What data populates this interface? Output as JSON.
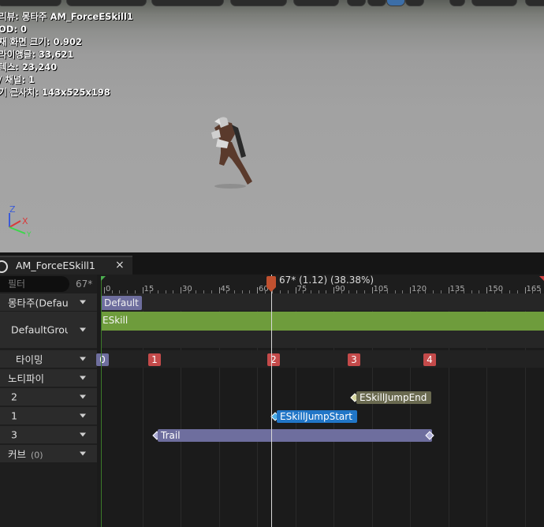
{
  "viewport": {
    "stats": [
      "리뷰: 몽타주 AM_ForceESkill1",
      "OD: 0",
      "재 화면 크기: 0.902",
      "라이앵글: 33,621",
      "텍스: 23,240",
      "/ 채널: 1",
      "기 근사치: 143x525x198"
    ],
    "axis": {
      "z": "Z",
      "x": "X",
      "y": "Y"
    }
  },
  "tab": {
    "title": "AM_ForceESkill1",
    "close": "×"
  },
  "left": {
    "filter_placeholder": "필터",
    "frame": "67*",
    "rows": {
      "montage": "몽타주(Defau",
      "group": "DefaultGroup",
      "timing": "타이밍",
      "notify": "노티파이",
      "track2": "2",
      "track1": "1",
      "track3": "3",
      "curve": "커브",
      "curve_count": "(0)"
    }
  },
  "timeline": {
    "playhead_text": "67* (1.12) (38.38%)",
    "ticks": [
      "0",
      "15",
      "30",
      "45",
      "60",
      "75",
      "90",
      "105",
      "120",
      "135",
      "150",
      "165"
    ],
    "slot_name": "Default",
    "montage_section": "ESkill",
    "sections": [
      "0",
      "1",
      "2",
      "3",
      "4"
    ],
    "notifies": {
      "jump_end": "ESkillJumpEnd",
      "jump_start": "ESkillJumpStart",
      "trail": "Trail"
    }
  },
  "colors": {
    "montage_bar": "#6e9c3c",
    "section": "#c44a4a",
    "playhead": "#c0502f",
    "jump_start": "#2176c7",
    "jump_end": "#6a6a50",
    "trail": "#6e6e9e"
  }
}
